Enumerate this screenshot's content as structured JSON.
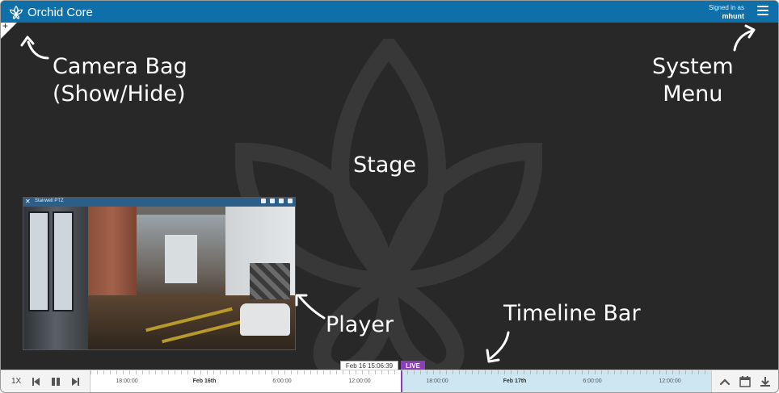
{
  "app": {
    "title": "Orchid Core"
  },
  "header": {
    "signed_in_label": "Signed in as",
    "username": "mhunt"
  },
  "player": {
    "title": "Stairwell PTZ"
  },
  "annotations": {
    "camera_bag": [
      "Camera Bag",
      "(Show/Hide)"
    ],
    "system_menu": [
      "System",
      "Menu"
    ],
    "stage": "Stage",
    "player": "Player",
    "timeline_bar": "Timeline Bar"
  },
  "timeline": {
    "current_time": "Feb 16 15:06:39",
    "live_badge": "LIVE",
    "speed": "1X",
    "ticks": [
      {
        "label": "18:00:00",
        "bold": false
      },
      {
        "label": "Feb 16th",
        "bold": true
      },
      {
        "label": "6:00:00",
        "bold": false
      },
      {
        "label": "12:00:00",
        "bold": false
      },
      {
        "label": "18:00:00",
        "bold": false
      },
      {
        "label": "Feb 17th",
        "bold": true
      },
      {
        "label": "6:00:00",
        "bold": false
      },
      {
        "label": "12:00:00",
        "bold": false
      }
    ]
  },
  "colors": {
    "header": "#0f6fa8",
    "stage": "#282828",
    "live": "#8a3fb5",
    "timeline_future": "#cde6f1"
  },
  "icons": [
    "orchid-logo-icon",
    "hamburger-menu-icon",
    "skip-back-icon",
    "pause-icon",
    "skip-forward-icon",
    "chevron-up-icon",
    "calendar-icon",
    "download-icon"
  ]
}
